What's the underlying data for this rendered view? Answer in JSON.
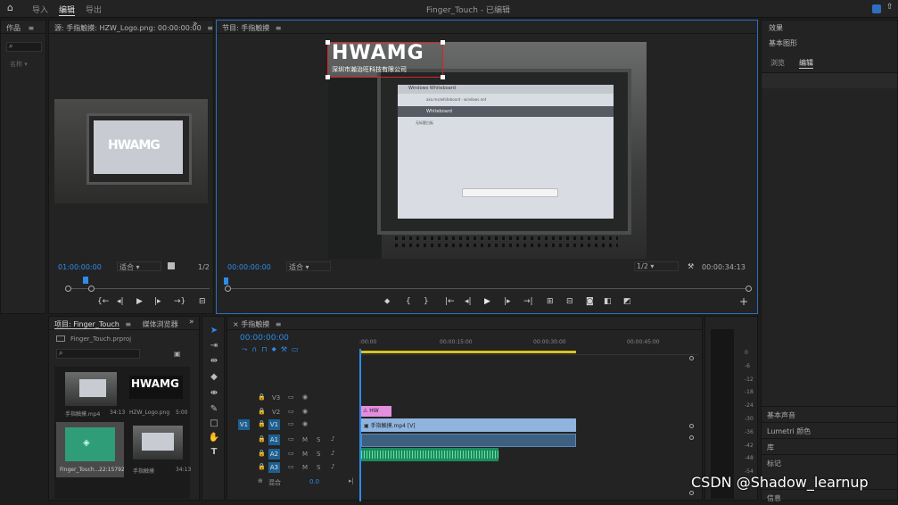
{
  "topbar": {
    "home": "⌂",
    "tab_import": "导入",
    "tab_edit": "编辑",
    "tab_export": "导出",
    "title": "Finger_Touch - 已编辑"
  },
  "left_panel": {
    "title": "作品",
    "search_icon": "⌕",
    "sort": "名称 ▾"
  },
  "source": {
    "title": "源: 手指触摸: HZW_Logo.png: 00:00:00:00",
    "timecode": "01:00:00:00",
    "fit": "适合",
    "ratio": "1/2"
  },
  "program": {
    "title": "节目: 手指触摸",
    "timecode": "00:00:00:00",
    "fit": "适合",
    "ratio": "1/2",
    "duration": "00:00:34:13",
    "logo_text": "HWAMG",
    "logo_sub": "深圳市瀚治旺科技有限公司",
    "tablet_tab": "Windows Whiteboard",
    "tablet_url": "aka.ms/whiteboard · windows.net",
    "tablet_app": "Whiteboard",
    "tablet_sub": "无标题白板"
  },
  "project": {
    "tab_project": "项目: Finger_Touch",
    "tab_media": "媒体浏览器",
    "file": "Finger_Touch.prproj",
    "items": [
      {
        "name": "手指触摸.mp4",
        "dur": "34:13"
      },
      {
        "name": "HZW_Logo.png",
        "dur": "5:00"
      },
      {
        "name": "Finger_Touch...",
        "dur": "22:15792"
      },
      {
        "name": "手指触摸",
        "dur": "34:13"
      }
    ]
  },
  "timeline": {
    "tab": "手指触摸",
    "timecode": "00:00:00:00",
    "ruler": [
      ":00:00",
      "00:00:15:00",
      "00:00:30:00",
      "00:00:45:00"
    ],
    "tracks": {
      "v3": "V3",
      "v2": "V2",
      "v1": "V1",
      "v1_src": "V1",
      "a1": "A1",
      "a2": "A2",
      "a3": "A3",
      "a1_src": "A1",
      "mix": "混合",
      "mix_val": "0.0",
      "m": "M",
      "s": "S"
    },
    "clip_logo": "HW",
    "clip_video": "手指触摸.mp4 [V]"
  },
  "right_panel": {
    "effects": "效果",
    "graphics": "基本图形",
    "tab_browse": "浏览",
    "tab_edit": "编辑",
    "items": [
      "基本声音",
      "Lumetri 颜色",
      "库",
      "标记",
      "信息"
    ]
  },
  "meter": {
    "scale": [
      "0",
      "-6",
      "-12",
      "-18",
      "-24",
      "-30",
      "-36",
      "-42",
      "-48",
      "-54"
    ]
  },
  "watermark": "CSDN @Shadow_learnup"
}
